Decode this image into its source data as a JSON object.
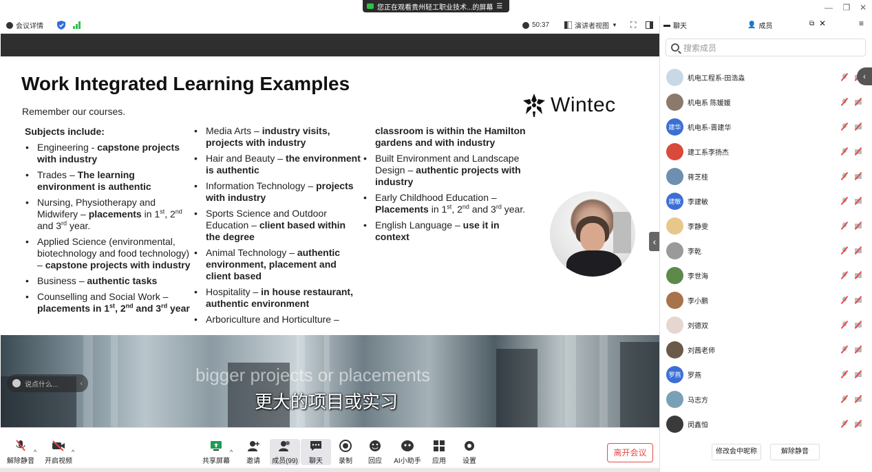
{
  "banner": {
    "text": "您正在观看贵州轻工职业技术...的屏幕"
  },
  "meeting_bar": {
    "info_label": "会议详情",
    "timer": "50:37",
    "view_mode": "演讲者视图"
  },
  "slide": {
    "title": "Work Integrated Learning Examples",
    "remember": "Remember our courses.",
    "subjects_heading": "Subjects include:",
    "logo_text": "Wintec",
    "col1": [
      {
        "plain": "Engineering - ",
        "bold": "capstone projects with industry"
      },
      {
        "plain": "Trades – ",
        "bold": "The learning environment is authentic"
      },
      {
        "plain": "Nursing, Physiotherapy and Midwifery – ",
        "bold": "placements",
        "tail_a": " in 1",
        "sup_a": "st",
        "tail_b": ", 2",
        "sup_b": "nd",
        "tail_c": " and 3",
        "sup_c": "rd",
        "tail_d": " year."
      },
      {
        "plain": "Applied Science (environmental, biotechnology and food technology) – ",
        "bold": "capstone projects with industry"
      },
      {
        "plain": "Business – ",
        "bold": "authentic tasks"
      },
      {
        "plain": "Counselling and Social Work – ",
        "bold_a": "placements in 1",
        "sup_a": "st",
        "bold_b": ", 2",
        "sup_b": "nd",
        "bold_c": " and 3",
        "sup_c": "rd",
        "bold_d": " year"
      }
    ],
    "col2": [
      {
        "plain": "Media Arts – ",
        "bold": "industry visits, projects with industry"
      },
      {
        "plain": "Hair and Beauty – ",
        "bold": "the environment is authentic"
      },
      {
        "plain": "Information Technology – ",
        "bold": "projects with industry"
      },
      {
        "plain": "Sports Science and Outdoor Education – ",
        "bold": "client based within the degree"
      },
      {
        "plain": "Animal Technology – ",
        "bold": "authentic environment, placement and client based"
      },
      {
        "plain": "Hospitality – ",
        "bold": "in house restaurant, authentic environment"
      },
      {
        "plain": "Arboriculture and Horticulture –",
        "bold": ""
      }
    ],
    "col3_cont": "classroom is within the Hamilton gardens and with industry",
    "col3": [
      {
        "plain": "Built Environment and Landscape Design – ",
        "bold": "authentic projects with industry"
      },
      {
        "plain": "Early Childhood Education – ",
        "bold": "Placements",
        "tail_a": " in 1",
        "sup_a": "st",
        "tail_b": ", 2",
        "sup_b": "nd",
        "tail_c": " and 3",
        "sup_c": "rd",
        "tail_d": " year."
      },
      {
        "plain": "English Language – ",
        "bold": "use it in context"
      }
    ]
  },
  "subtitles": {
    "english": "bigger projects or placements",
    "chinese": "更大的项目或实习"
  },
  "chat_input": {
    "placeholder": "说点什么..."
  },
  "toolbar": {
    "unmute": "解除静音",
    "start_video": "开启视频",
    "share_screen": "共享屏幕",
    "invite": "邀请",
    "members": "成员(99)",
    "chat": "聊天",
    "record": "录制",
    "reactions": "回应",
    "ai_assistant": "AI小助手",
    "apps": "应用",
    "settings": "设置",
    "leave": "离开会议"
  },
  "panel": {
    "tab_chat": "聊天",
    "tab_members": "成员",
    "search_placeholder": "搜索成员",
    "rename_button": "修改会中昵称",
    "unmute_all_button": "解除静音",
    "members": [
      {
        "name": "机电工程系-田浩淼",
        "avatar_text": "",
        "avatar_color": "#c8d8e6"
      },
      {
        "name": "机电系 陈媛媛",
        "avatar_text": "",
        "avatar_color": "#8b7a6c"
      },
      {
        "name": "机电系-晋建华",
        "avatar_text": "建华",
        "avatar_color": "#3b6fd4"
      },
      {
        "name": "建工系李扬杰",
        "avatar_text": "",
        "avatar_color": "#d94a3a"
      },
      {
        "name": "蒋芝桂",
        "avatar_text": "",
        "avatar_color": "#6d8fb0"
      },
      {
        "name": "李建敏",
        "avatar_text": "建敏",
        "avatar_color": "#3b6fd4"
      },
      {
        "name": "李静雯",
        "avatar_text": "",
        "avatar_color": "#e8c88a"
      },
      {
        "name": "李乾",
        "avatar_text": "",
        "avatar_color": "#9a9a9a"
      },
      {
        "name": "李世海",
        "avatar_text": "",
        "avatar_color": "#5d8a4a"
      },
      {
        "name": "李小鹏",
        "avatar_text": "",
        "avatar_color": "#a8734a"
      },
      {
        "name": "刘德双",
        "avatar_text": "",
        "avatar_color": "#e6d6d0"
      },
      {
        "name": "刘茜老师",
        "avatar_text": "",
        "avatar_color": "#6a5a4a"
      },
      {
        "name": "罗燕",
        "avatar_text": "罗燕",
        "avatar_color": "#3b6fd4"
      },
      {
        "name": "马志方",
        "avatar_text": "",
        "avatar_color": "#7aa0b8"
      },
      {
        "name": "闵鑫恒",
        "avatar_text": "",
        "avatar_color": "#3a3a3a"
      }
    ]
  }
}
